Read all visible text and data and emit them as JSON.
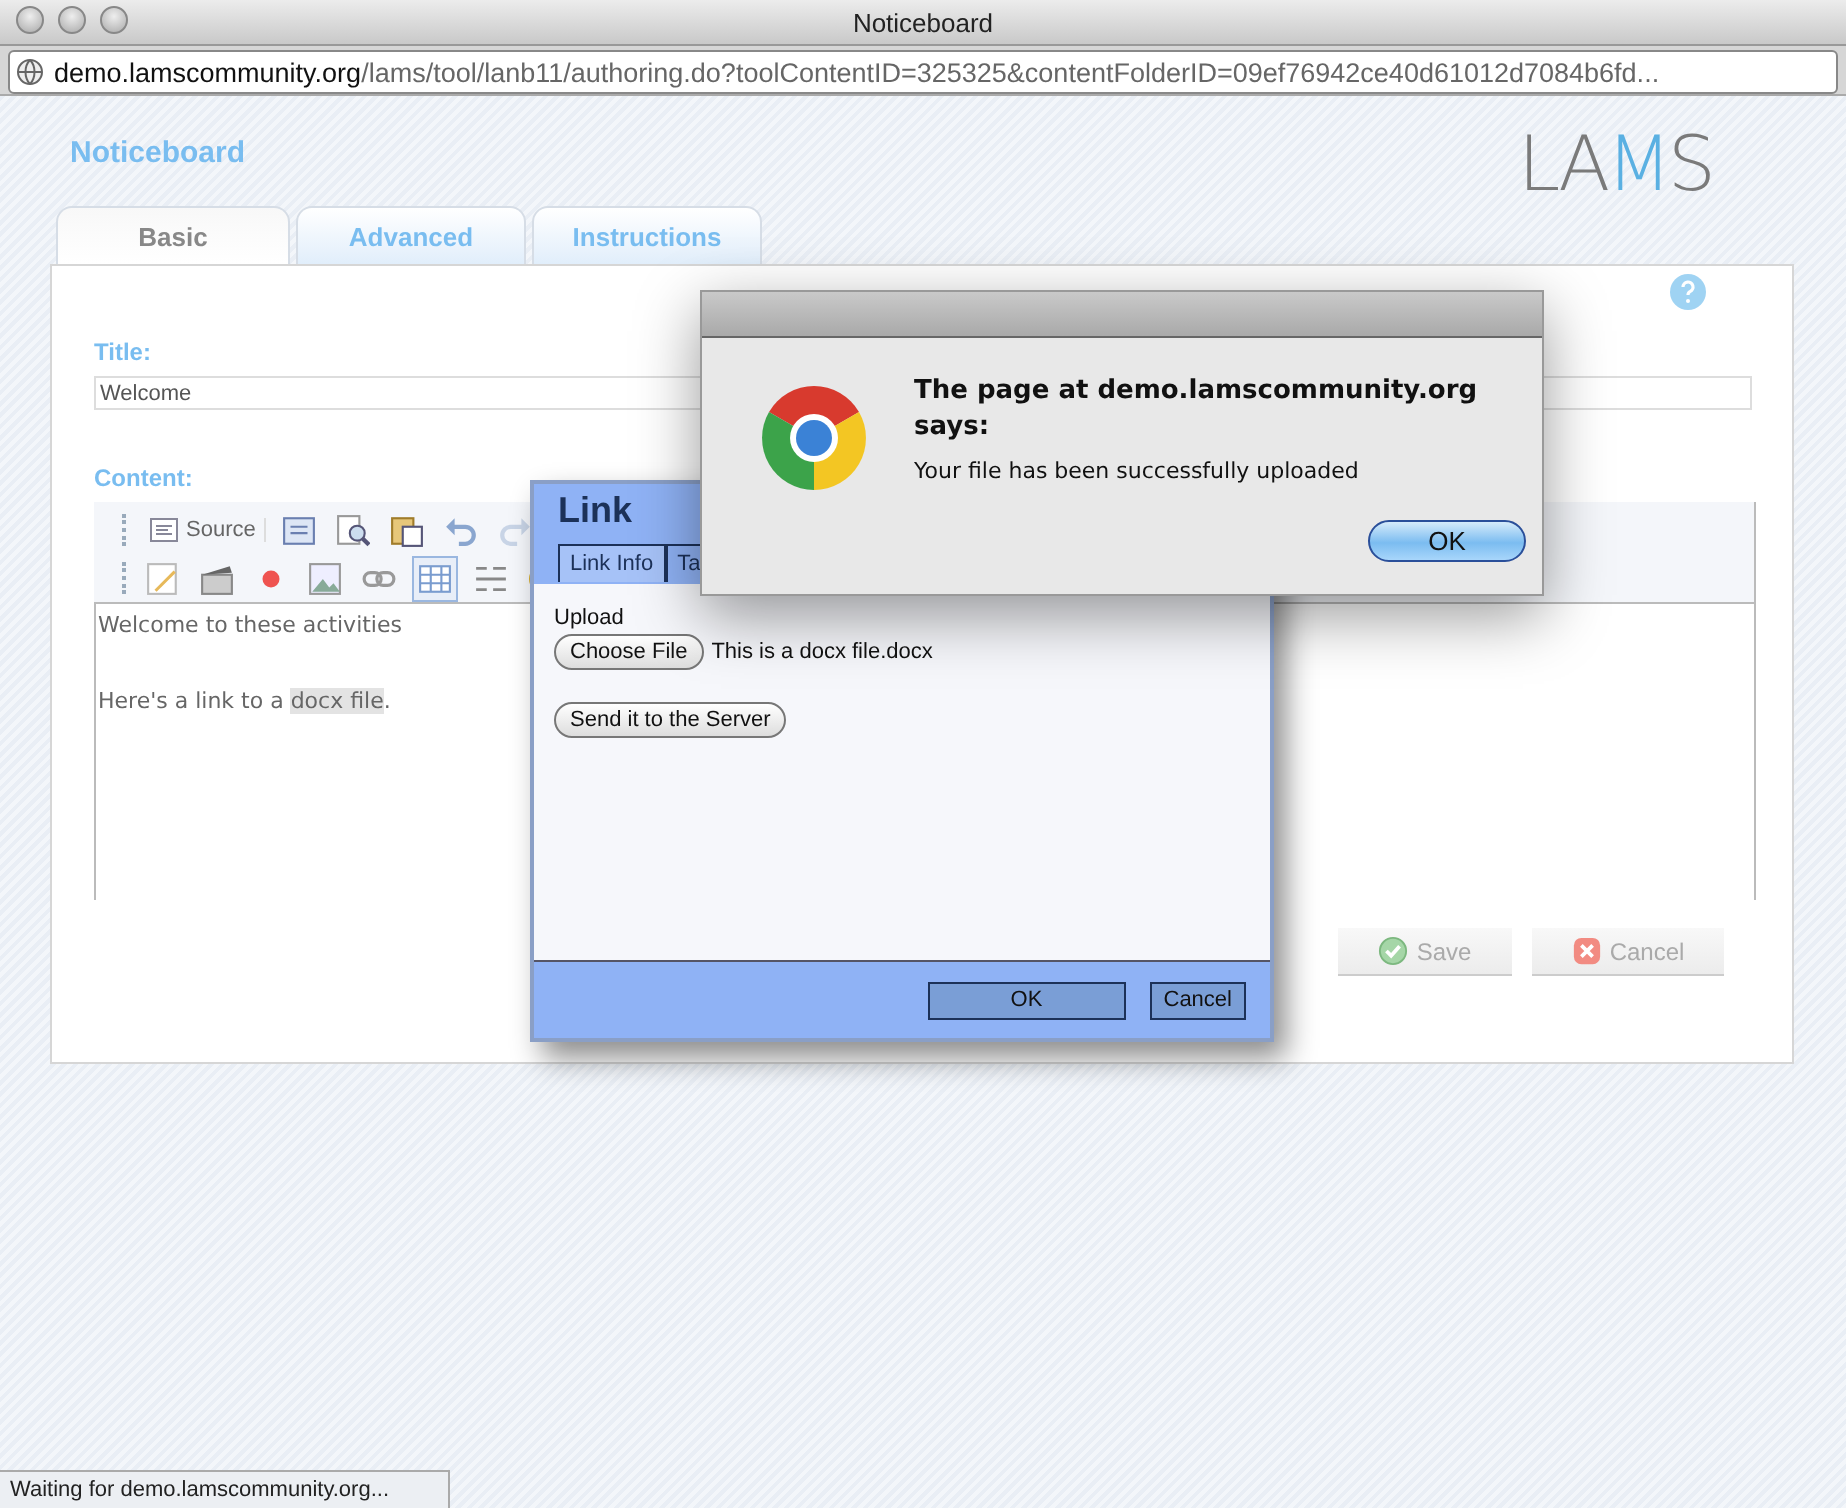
{
  "window": {
    "title": "Noticeboard"
  },
  "address_bar": {
    "domain": "demo.lamscommunity.org",
    "path": "/lams/tool/lanb11/authoring.do?toolContentID=325325&contentFolderID=09ef76942ce40d61012d7084b6fd..."
  },
  "page": {
    "heading": "Noticeboard",
    "logo": "LAMS"
  },
  "tabs": [
    {
      "label": "Basic",
      "selected": true
    },
    {
      "label": "Advanced",
      "selected": false
    },
    {
      "label": "Instructions",
      "selected": false
    }
  ],
  "form": {
    "title_label": "Title:",
    "title_value": "Welcome",
    "content_label": "Content:"
  },
  "editor": {
    "source_button": "Source",
    "lines": [
      {
        "kind": "text",
        "text": "Welcome to these activities"
      },
      {
        "kind": "blank"
      },
      {
        "kind": "link",
        "before": "Here's a link to a ",
        "link": "docx file",
        "after": "."
      }
    ]
  },
  "actions": [
    {
      "label": "Save",
      "kind": "save",
      "disabled": true
    },
    {
      "label": "Cancel",
      "kind": "cancel",
      "disabled": true
    }
  ],
  "link_dialog": {
    "title": "Link",
    "tabs": [
      {
        "label": "Link Info",
        "selected": true
      },
      {
        "label": "Ta",
        "selected": false
      }
    ],
    "upload_label": "Upload",
    "choose_button": "Choose File",
    "file_name": "This is a docx file.docx",
    "send_button": "Send it to the Server",
    "buttons": [
      {
        "label": "OK",
        "kind": "ok"
      },
      {
        "label": "Cancel",
        "kind": "cancel"
      }
    ]
  },
  "alert": {
    "heading": "The page at demo.lamscommunity.org says:",
    "message": "Your file has been successfully uploaded",
    "button": "OK"
  },
  "status_bar": {
    "text": "Waiting for demo.lamscommunity.org..."
  }
}
